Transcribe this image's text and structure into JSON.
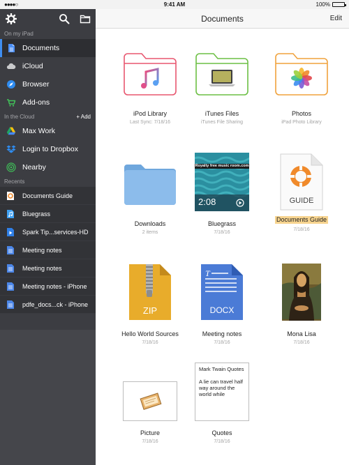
{
  "status_bar": {
    "carrier": "●●●●○",
    "time": "9:41 AM",
    "battery": "100%"
  },
  "sidebar": {
    "on_my_ipad": "On my iPad",
    "in_the_cloud": "In the Cloud",
    "add_label": "+ Add",
    "recents": "Recents",
    "local_items": [
      {
        "label": "Documents",
        "icon": "document-icon",
        "selected": true
      },
      {
        "label": "iCloud",
        "icon": "cloud-icon"
      },
      {
        "label": "Browser",
        "icon": "compass-icon"
      },
      {
        "label": "Add-ons",
        "icon": "cart-icon"
      }
    ],
    "cloud_items": [
      {
        "label": "Max Work",
        "icon": "google-drive-icon"
      },
      {
        "label": "Login to Dropbox",
        "icon": "dropbox-icon"
      },
      {
        "label": "Nearby",
        "icon": "nearby-icon"
      }
    ],
    "recent_items": [
      {
        "label": "Documents Guide",
        "icon": "guide-file-icon"
      },
      {
        "label": "Bluegrass",
        "icon": "audio-file-icon"
      },
      {
        "label": "Spark Tip...services-HD",
        "icon": "video-file-icon"
      },
      {
        "label": "Meeting notes",
        "icon": "word-file-icon"
      },
      {
        "label": "Meeting notes",
        "icon": "word-file-icon"
      },
      {
        "label": "Meeting notes - iPhone",
        "icon": "word-file-icon"
      },
      {
        "label": "pdfe_docs...ck - iPhone",
        "icon": "word-file-icon"
      }
    ]
  },
  "header": {
    "title": "Documents",
    "edit": "Edit"
  },
  "tiles": [
    {
      "name": "iPod Library",
      "sub": "Last Sync: 7/18/16",
      "icon": "music-folder-icon"
    },
    {
      "name": "iTunes Files",
      "sub": "iTunes File Sharing",
      "icon": "itunes-folder-icon"
    },
    {
      "name": "Photos",
      "sub": "iPad Photo Library",
      "icon": "photos-folder-icon"
    },
    {
      "name": "Downloads",
      "sub": "2 items",
      "icon": "folder-icon"
    },
    {
      "name": "Bluegrass",
      "sub": "7/18/16",
      "icon": "video-thumbnail",
      "duration": "2:08",
      "banner": "Royalty free music room.com"
    },
    {
      "name": "Documents Guide",
      "sub": "7/18/16",
      "icon": "guide-icon",
      "badge": "GUIDE"
    },
    {
      "name": "Hello World Sources",
      "sub": "7/18/16",
      "icon": "zip-icon",
      "badge": "ZIP"
    },
    {
      "name": "Meeting notes",
      "sub": "7/18/16",
      "icon": "docx-icon",
      "badge": "DOCX"
    },
    {
      "name": "Mona Lisa",
      "sub": "7/18/16",
      "icon": "image-thumbnail"
    },
    {
      "name": "Picture",
      "sub": "7/18/16",
      "icon": "picture-icon"
    },
    {
      "name": "Quotes",
      "sub": "7/18/16",
      "icon": "text-preview",
      "preview_title": "Mark Twain Quotes",
      "preview_body": "A lie can travel half way around the world while"
    }
  ]
}
